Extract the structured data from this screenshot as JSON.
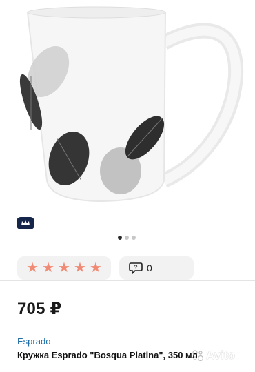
{
  "listing": {
    "price": "705 ₽",
    "brand": "Esprado",
    "title": "Кружка Esprado \"Bosqua Platina\", 350 мл"
  },
  "gallery": {
    "image_count": 3,
    "active_index": 0
  },
  "rating": {
    "stars": 5,
    "max_stars": 5,
    "star_color": "#f08a74"
  },
  "reviews": {
    "count": "0"
  },
  "badges": {
    "crown_color": "#16264a"
  },
  "watermark": {
    "text": "Avito"
  }
}
